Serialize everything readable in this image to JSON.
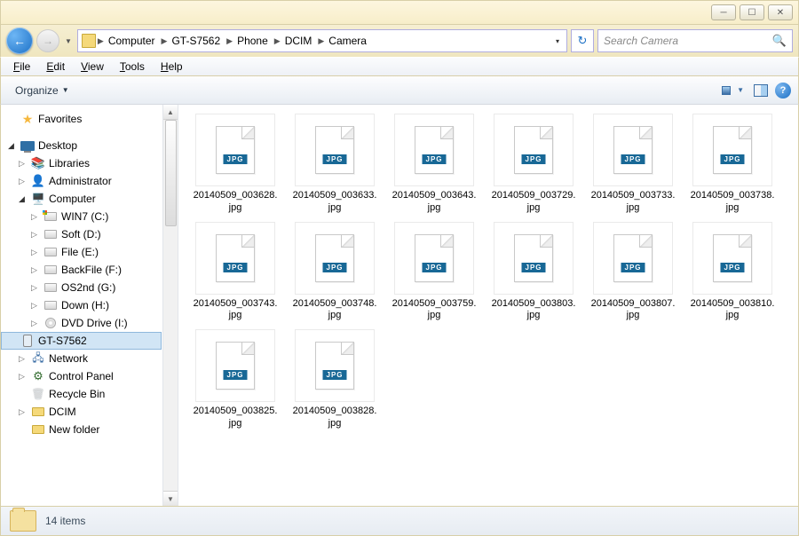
{
  "title_controls": {
    "min": "─",
    "max": "☐",
    "close": "✕"
  },
  "breadcrumb": [
    "Computer",
    "GT-S7562",
    "Phone",
    "DCIM",
    "Camera"
  ],
  "search_placeholder": "Search Camera",
  "menu": {
    "file": "File",
    "edit": "Edit",
    "view": "View",
    "tools": "Tools",
    "help": "Help"
  },
  "toolbar": {
    "organize": "Organize"
  },
  "tree": {
    "favorites": "Favorites",
    "desktop": "Desktop",
    "libraries": "Libraries",
    "administrator": "Administrator",
    "computer": "Computer",
    "drives": [
      {
        "label": "WIN7 (C:)",
        "type": "win"
      },
      {
        "label": "Soft (D:)",
        "type": "drive"
      },
      {
        "label": "File (E:)",
        "type": "drive"
      },
      {
        "label": "BackFile (F:)",
        "type": "drive"
      },
      {
        "label": "OS2nd (G:)",
        "type": "drive"
      },
      {
        "label": "Down (H:)",
        "type": "drive"
      },
      {
        "label": "DVD Drive (I:)",
        "type": "cd"
      },
      {
        "label": "GT-S7562",
        "type": "phone",
        "selected": true
      }
    ],
    "network": "Network",
    "controlpanel": "Control Panel",
    "recyclebin": "Recycle Bin",
    "dcim": "DCIM",
    "newfolder": "New folder"
  },
  "files": [
    "20140509_003628.jpg",
    "20140509_003633.jpg",
    "20140509_003643.jpg",
    "20140509_003729.jpg",
    "20140509_003733.jpg",
    "20140509_003738.jpg",
    "20140509_003743.jpg",
    "20140509_003748.jpg",
    "20140509_003759.jpg",
    "20140509_003803.jpg",
    "20140509_003807.jpg",
    "20140509_003810.jpg",
    "20140509_003825.jpg",
    "20140509_003828.jpg"
  ],
  "file_badge": "JPG",
  "status": {
    "count": "14 items"
  }
}
